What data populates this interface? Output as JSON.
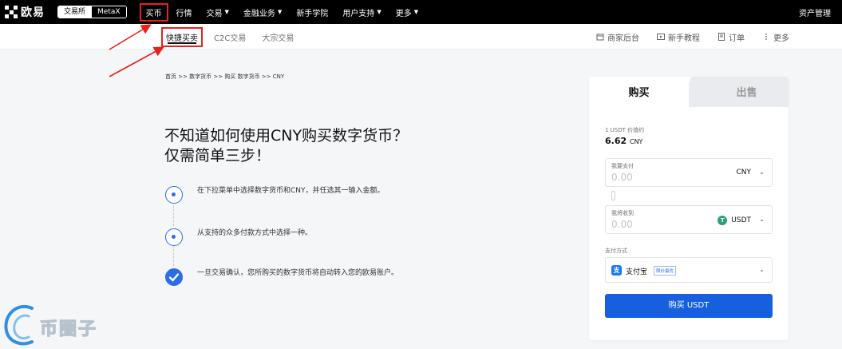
{
  "topnav": {
    "logo_text": "欧易",
    "mode_exchange": "交易所",
    "mode_web3": "MetaX",
    "items": [
      {
        "label": "买币",
        "dropdown": false,
        "active": true
      },
      {
        "label": "行情",
        "dropdown": false
      },
      {
        "label": "交易",
        "dropdown": true
      },
      {
        "label": "金融业务",
        "dropdown": true
      },
      {
        "label": "新手学院",
        "dropdown": false
      },
      {
        "label": "用户支持",
        "dropdown": true
      },
      {
        "label": "更多",
        "dropdown": true
      }
    ],
    "asset_mgmt": "资产管理"
  },
  "subnav": {
    "tabs": [
      {
        "label": "快捷买卖",
        "active": true
      },
      {
        "label": "C2C交易"
      },
      {
        "label": "大宗交易"
      }
    ],
    "right_links": [
      {
        "label": "商家后台",
        "icon": "merchant-icon"
      },
      {
        "label": "新手教程",
        "icon": "video-icon"
      },
      {
        "label": "订单",
        "icon": "order-icon"
      },
      {
        "label": "更多",
        "icon": "more-dots-icon"
      }
    ]
  },
  "breadcrumb": "首页 >> 数字货币 >> 购买 数字货币 >> CNY",
  "headline_line1": "不知道如何使用CNY购买数字货币？",
  "headline_line2": "仅需简单三步！",
  "steps": [
    {
      "text": "在下拉菜单中选择数字货币和CNY，并任选其一输入金额。",
      "state": "pending"
    },
    {
      "text": "从支持的众多付款方式中选择一种。",
      "state": "pending"
    },
    {
      "text": "一旦交易确认，您所购买的数字货币将自动转入您的欧易账户。",
      "state": "done"
    }
  ],
  "card": {
    "tab_buy": "购买",
    "tab_sell": "出售",
    "price_label": "1 USDT 价值约",
    "price_value": "6.62",
    "price_currency": "CNY",
    "pay_field": {
      "label": "我要支付",
      "placeholder": "0.00",
      "currency": "CNY"
    },
    "receive_field": {
      "label": "我将收到",
      "placeholder": "0.00",
      "currency": "USDT"
    },
    "payment_label": "支付方式",
    "payment_name": "支付宝",
    "payment_badge": "限价最优",
    "buy_button": "购买 USDT"
  },
  "watermark_text": "币圈子",
  "colors": {
    "accent_blue": "#1660e0",
    "annotation_red": "#e8201a",
    "nav_bg": "#000000",
    "usdt_green": "#26a17b"
  }
}
